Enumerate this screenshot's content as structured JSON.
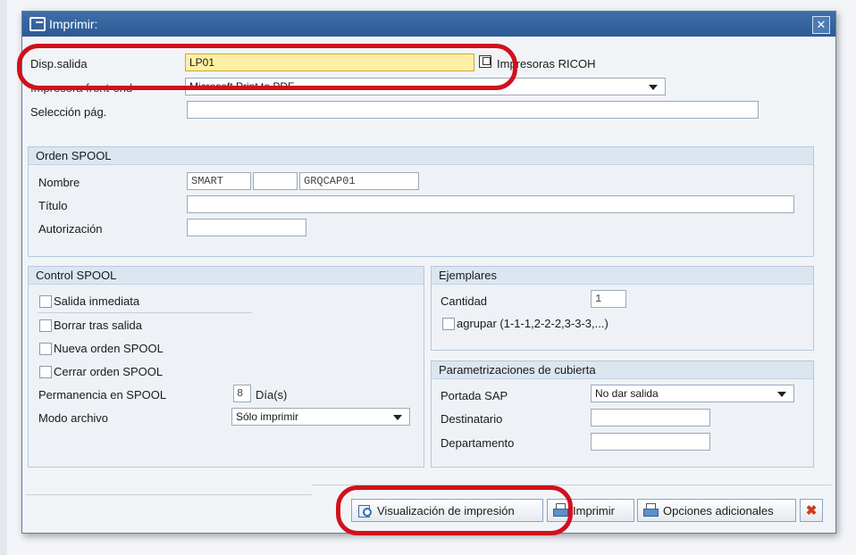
{
  "dialog": {
    "title": "Imprimir:"
  },
  "output": {
    "device_label": "Disp.salida",
    "device_value": "LP01",
    "device_desc": "Impresoras RICOH",
    "frontend_label": "Impresora front-end",
    "frontend_value": "Microsoft Print to PDF",
    "page_sel_label": "Selección pág.",
    "page_sel_value": ""
  },
  "spool_order": {
    "header": "Orden SPOOL",
    "name_label": "Nombre",
    "name_1": "SMART",
    "name_2": "",
    "name_3": "GRQCAP01",
    "title_label": "Título",
    "title_value": "",
    "auth_label": "Autorización",
    "auth_value": ""
  },
  "spool_control": {
    "header": "Control SPOOL",
    "immediate": "Salida inmediata",
    "delete_after": "Borrar tras salida",
    "new_order": "Nueva orden SPOOL",
    "close_order": "Cerrar orden SPOOL",
    "retention_label": "Permanencia en SPOOL",
    "retention_value": "8",
    "retention_unit": "Día(s)",
    "archive_label": "Modo archivo",
    "archive_value": "Sólo imprimir"
  },
  "copies": {
    "header": "Ejemplares",
    "quantity_label": "Cantidad",
    "quantity_value": "1",
    "group_label": "agrupar (1-1-1,2-2-2,3-3-3,...)"
  },
  "cover": {
    "header": "Parametrizaciones de cubierta",
    "sap_cover_label": "Portada SAP",
    "sap_cover_value": "No dar salida",
    "recipient_label": "Destinatario",
    "recipient_value": "",
    "dept_label": "Departamento",
    "dept_value": ""
  },
  "toolbar": {
    "preview": "Visualización de impresión",
    "print": "Imprimir",
    "more_options": "Opciones adicionales"
  },
  "colors": {
    "highlight": "#d0111c",
    "title_bar": "#2c5a94",
    "active_field": "#fdf0a6"
  }
}
